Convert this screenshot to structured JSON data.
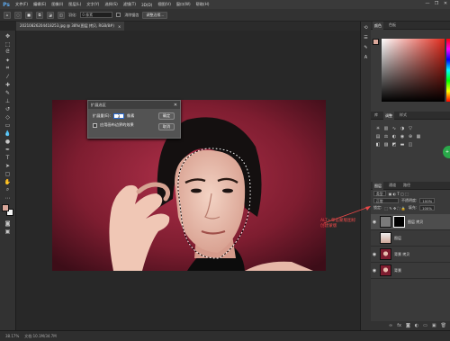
{
  "app": {
    "logo": "Ps"
  },
  "menu": [
    "文件(F)",
    "编辑(E)",
    "图像(I)",
    "图层(L)",
    "文字(Y)",
    "选择(S)",
    "滤镜(T)",
    "3D(D)",
    "视图(V)",
    "窗口(W)",
    "帮助(H)"
  ],
  "window_controls": [
    "—",
    "❐",
    "✕"
  ],
  "options": {
    "feather_label": "羽化:",
    "feather_value": "0 像素",
    "antialias_label": "消除锯齿",
    "refine_button": "调整边缘..."
  },
  "document_tab": {
    "title": "20210826204418253.jpg @ 38%(图层 拷贝, RGB/8#)",
    "close": "×"
  },
  "dialog": {
    "title": "扩展选区",
    "close": "✕",
    "expand_label": "扩展量(E):",
    "expand_value": "3",
    "unit": "像素",
    "canvas_bounds_label": "应用画布边界的效果",
    "ok": "确定",
    "cancel": "取消"
  },
  "panels": {
    "color_tabs": [
      "颜色",
      "色板"
    ],
    "adjust_tabs": [
      "库",
      "调整",
      "样式"
    ],
    "layer_tabs": [
      "图层",
      "通道",
      "路径"
    ],
    "layer_kind": "类型",
    "layer_mode": "正常",
    "opacity_label": "不透明度:",
    "opacity_value": "100%",
    "lock_label": "锁定:",
    "fill_label": "填充:",
    "fill_value": "100%"
  },
  "layers": [
    {
      "name": "图层 拷贝",
      "selected": true
    },
    {
      "name": "图层"
    },
    {
      "name": "背景 拷贝"
    },
    {
      "name": "背景"
    }
  ],
  "annotation": "ALT+单击蒙版图标创建蒙版",
  "status": {
    "zoom": "38.17%",
    "doc": "文档:10.1M/34.7M"
  }
}
